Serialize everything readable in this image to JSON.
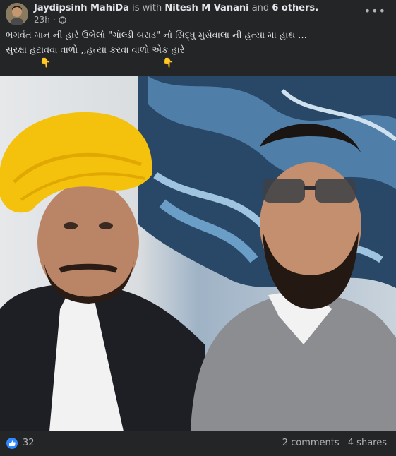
{
  "post": {
    "author": "Jaydipsinh MahiDa",
    "with_text": "is with",
    "tagged": "Nitesh M Vanani",
    "and_text": "and",
    "others": "6 others.",
    "time": "23h",
    "privacy_icon": "globe-icon",
    "more_icon": "more-options-icon",
    "text_line1": "ભગવંત માન ની હારે ઉભેલો \"ગોલ્ડી બરાડ\" નો સિદ્ધુ મુસેવાલા ની હત્યા મા હાથ ...",
    "text_line2": "સુરક્ષા હટાવવા વાળો ,,હત્યા કરવા વાળો એક હારે",
    "pointer_emoji": "👇"
  },
  "footer": {
    "reaction_icon": "like-icon",
    "reaction_color": "#2e89ff",
    "likes": "32",
    "comments": "2 comments",
    "shares": "4 shares"
  }
}
